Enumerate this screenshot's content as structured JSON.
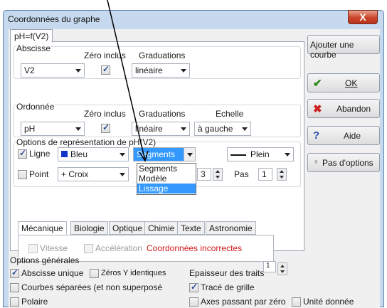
{
  "window": {
    "title": "Coordonnées du graphe",
    "close_glyph": "X"
  },
  "tabs": {
    "main": "pH=f(V2)"
  },
  "abscisse": {
    "label": "Abscisse",
    "zero_label": "Zéro inclus",
    "grad_label": "Graduations",
    "variable": "V2",
    "zero_checked": true,
    "graduation": "linéaire"
  },
  "ordonnee": {
    "label": "Ordonnée",
    "zero_label": "Zéro inclus",
    "grad_label": "Graduations",
    "scale_label": "Echelle",
    "variable": "pH",
    "zero_checked": true,
    "graduation": "linéaire",
    "scale": "à gauche"
  },
  "representation": {
    "label": "Options de représentation de pH(V2)",
    "line_label": "Ligne",
    "line_checked": true,
    "color_label": "Bleu",
    "color_hex": "#1133cc",
    "mode_value": "Segments",
    "style_value": "Plein",
    "point_label": "Point",
    "point_checked": false,
    "point_symbol": "+ Croix",
    "size_value": "3",
    "pas_label": "Pas",
    "pas_value": "1"
  },
  "dropdown": {
    "items": [
      "Segments",
      "Modèle",
      "Lissage"
    ],
    "selected_index": 2
  },
  "subtabs": [
    "Mécanique",
    "Biologie",
    "Optique",
    "Chimie",
    "Texte",
    "Astronomie"
  ],
  "mecanique": {
    "vitesse": "Vitesse",
    "acceleration": "Accélération",
    "warning": "Coordonnées incorrectes"
  },
  "general": {
    "label": "Options générales",
    "abscisse_unique": "Abscisse unique",
    "abscisse_unique_checked": true,
    "zeros_y": "Zéros Y identiques",
    "zeros_y_checked": false,
    "epaisseur_label": "Epaisseur des traits",
    "epaisseur_value": "1",
    "courbes_sep": "Courbes séparées (et non superposé",
    "courbes_sep_checked": false,
    "trace_grille": "Tracé de grille",
    "trace_grille_checked": true,
    "polaire": "Polaire",
    "polaire_checked": false,
    "axes_zero": "Axes passant par zéro",
    "axes_zero_checked": false,
    "unite": "Unité donnée",
    "unite_checked": false
  },
  "buttons": {
    "add_curve": "Ajouter une courbe",
    "ok": "OK",
    "ok_icon": "check-icon",
    "cancel": "Abandon",
    "cancel_icon": "cross-icon",
    "help": "Aide",
    "help_icon": "question-icon",
    "no_options": "Pas d'options",
    "no_options_icon": "bulb-icon"
  },
  "colors": {
    "ok_green": "#2d8a1e",
    "cancel_red": "#cc2020",
    "help_blue": "#2d4fb0",
    "selection": "#3399ff"
  }
}
